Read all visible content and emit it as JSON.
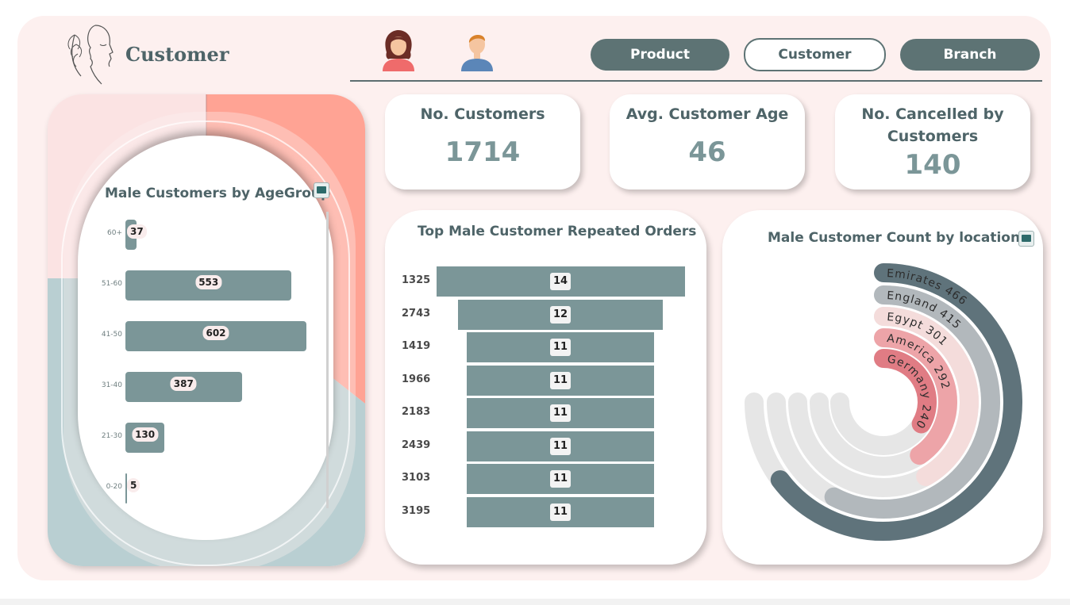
{
  "header": {
    "title": "Customer",
    "nav": [
      {
        "label": "Product",
        "active": false
      },
      {
        "label": "Customer",
        "active": true
      },
      {
        "label": "Branch",
        "active": false
      }
    ]
  },
  "kpis": [
    {
      "title": "No. Customers",
      "value": "1714"
    },
    {
      "title": "Avg. Customer Age",
      "value": "46"
    },
    {
      "title": "No. Cancelled by Customers",
      "value": "140"
    }
  ],
  "colors": {
    "accent": "#7b9698",
    "nav_dark": "#5d7374",
    "background": "#fdf0ef",
    "salmon": "#ffa394",
    "teal_light": "#b9cfd2"
  },
  "chart_data": [
    {
      "type": "bar",
      "orientation": "horizontal",
      "title": "Male Customers by AgeGroup",
      "categories": [
        "60+",
        "51-60",
        "41-50",
        "31-40",
        "21-30",
        "0-20"
      ],
      "values": [
        37,
        553,
        602,
        387,
        130,
        5
      ],
      "xlim": [
        0,
        602
      ]
    },
    {
      "type": "bar",
      "orientation": "funnel",
      "title": "Top Male Customer Repeated Orders",
      "categories": [
        "1325",
        "2743",
        "1419",
        "1966",
        "2183",
        "2439",
        "3103",
        "3195"
      ],
      "values": [
        14,
        12,
        11,
        11,
        11,
        11,
        11,
        11
      ]
    },
    {
      "type": "radial-bar",
      "title": "Male Customer Count by location",
      "categories": [
        "Emirates",
        "England",
        "Egypt",
        "America",
        "Germany"
      ],
      "values": [
        466,
        415,
        301,
        292,
        240
      ],
      "labels": [
        "Emirates 466",
        "England 415",
        "Egypt 301",
        "America 292",
        "Germany 240"
      ],
      "colors": [
        "#5f737b",
        "#b2b8bc",
        "#f4dcdb",
        "#eda4a8",
        "#e07c84"
      ]
    }
  ]
}
